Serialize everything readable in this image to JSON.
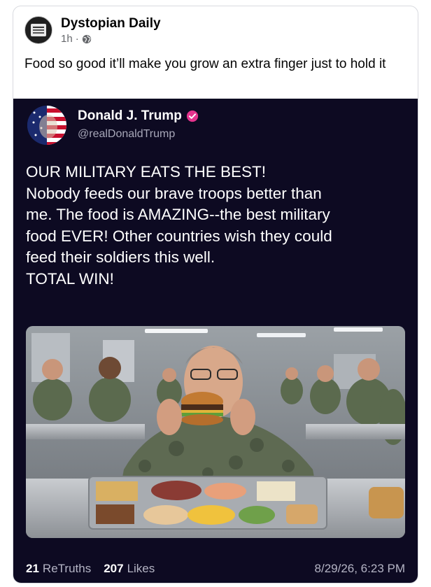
{
  "post": {
    "page_name": "Dystopian Daily",
    "time": "1h",
    "separator": "·",
    "audience_icon": "globe-icon",
    "caption": "Food so good it’ll make you grow an extra finger just to hold it"
  },
  "truth": {
    "display_name": "Donald J. Trump",
    "verified_icon": "verified-badge-icon",
    "handle": "@realDonaldTrump",
    "lines": [
      "OUR MILITARY EATS THE BEST!",
      "Nobody feeds our brave troops better than",
      "me. The food is AMAZING--the best military",
      "food EVER! Other countries wish they could",
      "feed their soldiers this well.",
      "TOTAL WIN!"
    ],
    "image_subject": "military-mess-hall-photo",
    "retruths_count": "21",
    "retruths_label": "ReTruths",
    "likes_count": "207",
    "likes_label": "Likes",
    "date": "8/29/26, 6:23 PM"
  },
  "colors": {
    "embed_bg": "#0d0a22",
    "verified": "#e5338d",
    "muted_text": "#b4b4c4"
  }
}
